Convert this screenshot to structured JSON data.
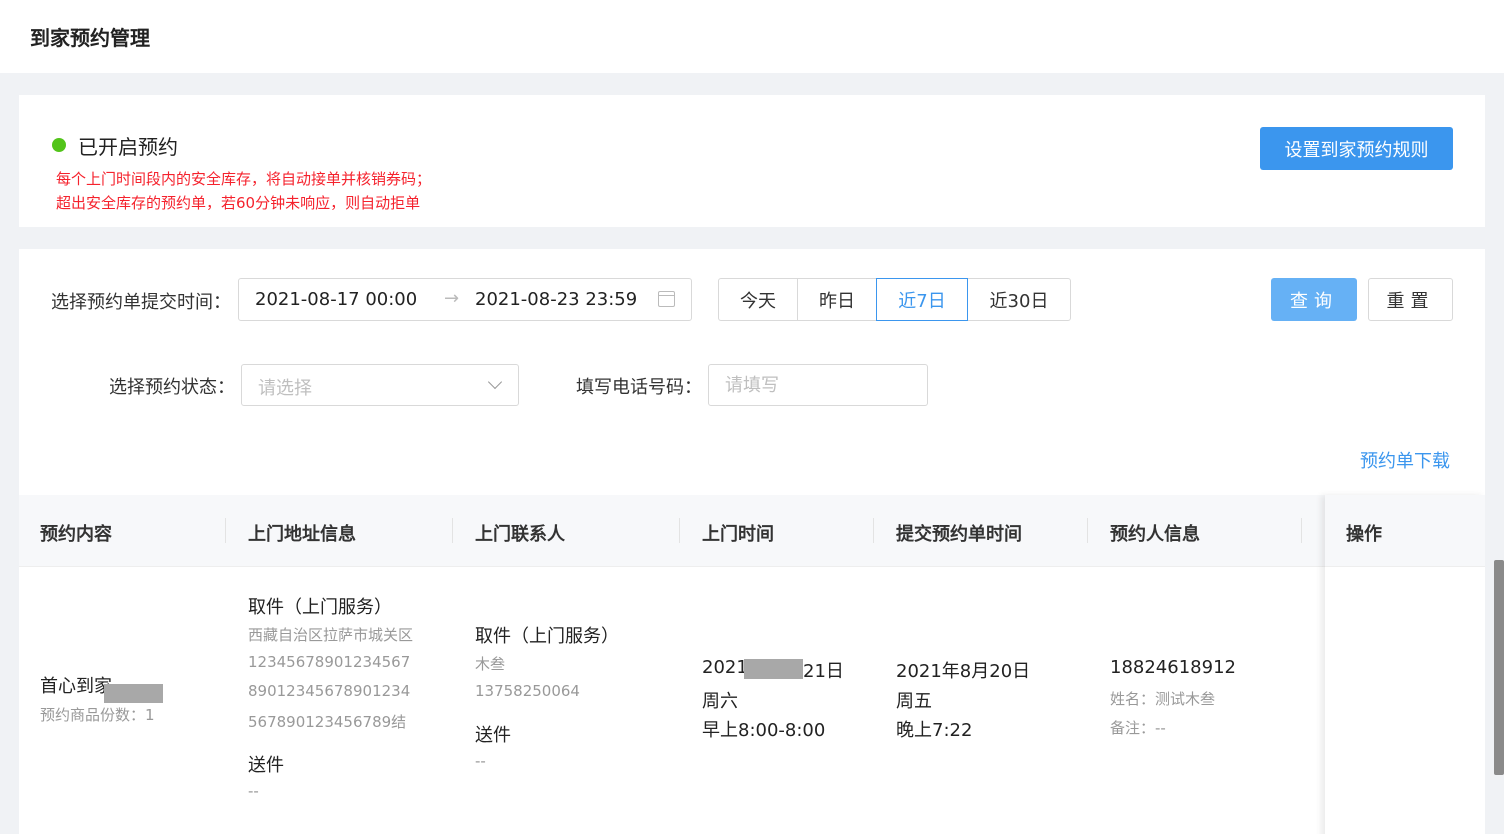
{
  "header": {
    "title": "到家预约管理"
  },
  "status": {
    "label": "已开启预约",
    "color": "#52c41a",
    "notice_line1": "每个上门时间段内的安全库存，将自动接单并核销券码；",
    "notice_line2": "超出安全库存的预约单，若60分钟未响应，则自动拒单",
    "rule_button": "设置到家预约规则"
  },
  "filters": {
    "submit_time_label": "选择预约单提交时间：",
    "range_start": "2021-08-17 00:00",
    "range_arrow": "→",
    "range_end": "2021-08-23 23:59",
    "quick": [
      {
        "label": "今天"
      },
      {
        "label": "昨日"
      },
      {
        "label": "近7日",
        "active": true
      },
      {
        "label": "近30日"
      }
    ],
    "query_button": "查询",
    "reset_button": "重置",
    "status_label": "选择预约状态：",
    "status_placeholder": "请选择",
    "phone_label": "填写电话号码：",
    "phone_placeholder": "请填写",
    "download_link": "预约单下载"
  },
  "table": {
    "columns": [
      "预约内容",
      "上门地址信息",
      "上门联系人",
      "上门时间",
      "提交预约单时间",
      "预约人信息",
      "操作"
    ],
    "row": {
      "content_title": "首心到家",
      "content_count": "预约商品份数：1",
      "addr_pickup_title": "取件（上门服务）",
      "addr_line1": "西藏自治区拉萨市城关区",
      "addr_line2": "12345678901234567",
      "addr_line3": "89012345678901234",
      "addr_line4": "567890123456789结",
      "addr_deliver_title": "送件",
      "addr_deliver_value": "--",
      "contact_pickup_title": "取件（上门服务）",
      "contact_name": "木叁",
      "contact_phone": "13758250064",
      "contact_deliver_title": "送件",
      "contact_deliver_value": "--",
      "visit_date_start": "2021",
      "visit_date_end": "21日",
      "visit_weekday": "周六",
      "visit_slot": "早上8:00-8:00",
      "submit_date": "2021年8月20日",
      "submit_weekday": "周五",
      "submit_time": "晚上7:22",
      "booker_phone": "18824618912",
      "booker_name": "姓名：测试木叁",
      "booker_note": "备注：--"
    }
  }
}
